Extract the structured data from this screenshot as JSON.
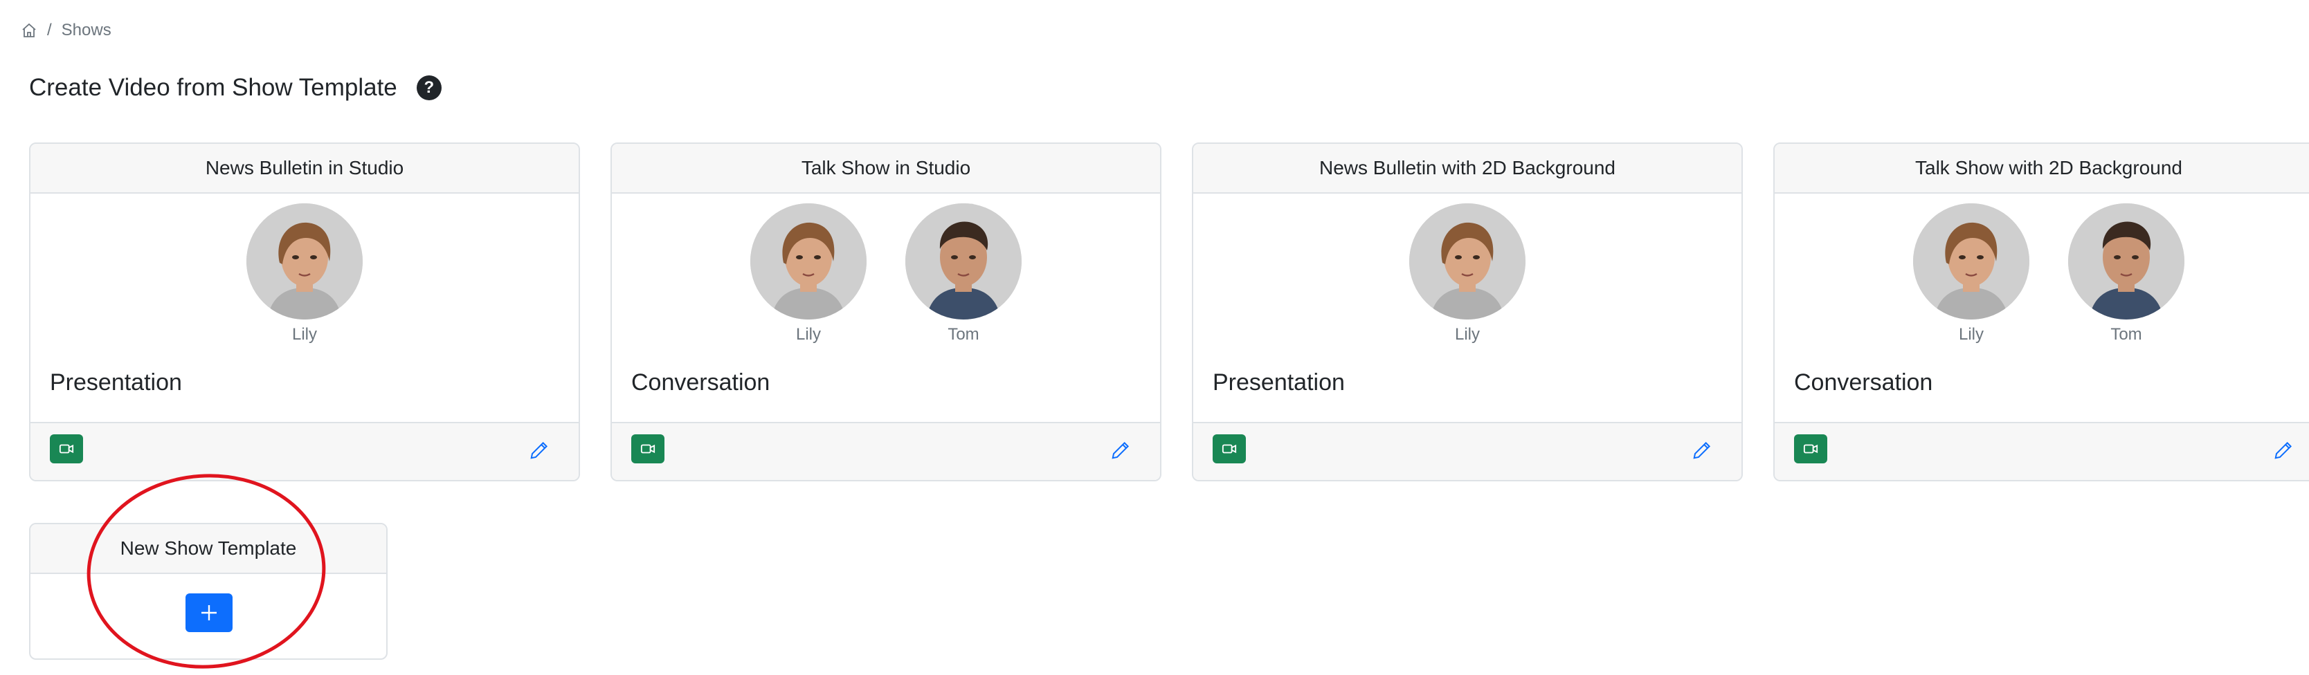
{
  "breadcrumb": {
    "home_icon": "home-icon",
    "separator": "/",
    "current": "Shows"
  },
  "page": {
    "title": "Create Video from Show Template",
    "help_label": "?"
  },
  "cards": [
    {
      "title": "News Bulletin in Studio",
      "type": "Presentation",
      "avatars": [
        "Lily"
      ],
      "actions": {
        "video_icon": "video-camera-icon",
        "edit_icon": "pencil-icon"
      }
    },
    {
      "title": "Talk Show in Studio",
      "type": "Conversation",
      "avatars": [
        "Lily",
        "Tom"
      ],
      "actions": {
        "video_icon": "video-camera-icon",
        "edit_icon": "pencil-icon"
      }
    },
    {
      "title": "News Bulletin with 2D Background",
      "type": "Presentation",
      "avatars": [
        "Lily"
      ],
      "actions": {
        "video_icon": "video-camera-icon",
        "edit_icon": "pencil-icon"
      }
    },
    {
      "title": "Talk Show with 2D Background",
      "type": "Conversation",
      "avatars": [
        "Lily",
        "Tom"
      ],
      "actions": {
        "video_icon": "video-camera-icon",
        "edit_icon": "pencil-icon"
      }
    }
  ],
  "new_template": {
    "title": "New Show Template",
    "button_icon": "plus-icon"
  },
  "colors": {
    "video_button": "#198754",
    "plus_button": "#0d6efd",
    "edit_icon": "#0d6efd",
    "annotation_circle": "#e0141e"
  }
}
